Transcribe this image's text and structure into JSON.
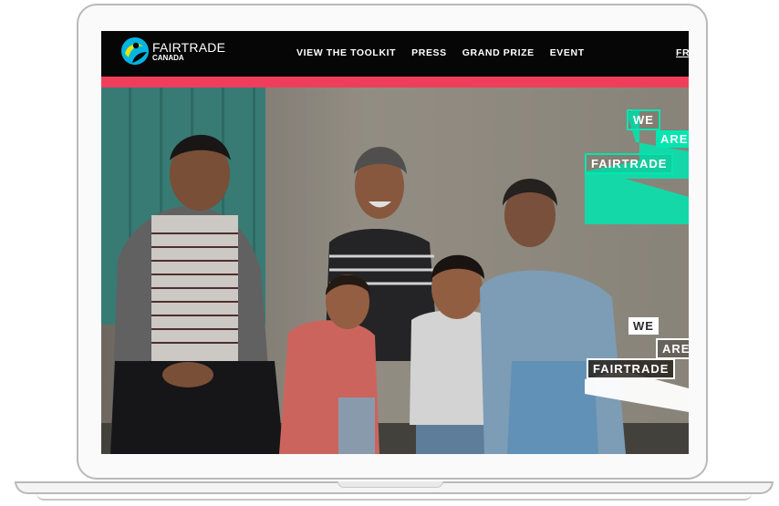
{
  "nav": {
    "logo": {
      "name": "FAIRTRADE",
      "sub": "CANADA"
    },
    "items": [
      {
        "label": "VIEW THE TOOLKIT"
      },
      {
        "label": "PRESS"
      },
      {
        "label": "GRAND PRIZE"
      },
      {
        "label": "EVENT"
      }
    ],
    "lang": "FR"
  },
  "colors": {
    "stripe": "#ef3e5c",
    "badge_green": "#00e6b0",
    "badge_white": "#ffffff"
  },
  "hero": {
    "badge_top": {
      "we": "WE",
      "are": "ARE",
      "fairtrade": "FAIRTRADE"
    },
    "badge_bottom": {
      "we": "WE",
      "are": "ARE",
      "fairtrade": "FAIRTRADE"
    }
  }
}
